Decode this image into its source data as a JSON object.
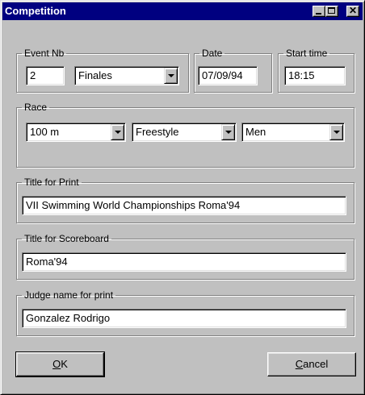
{
  "window": {
    "title": "Competition"
  },
  "titlebar_buttons": {
    "minimize_icon": "minimize-icon",
    "maximize_icon": "maximize-icon",
    "close_icon": "close-icon",
    "close_glyph": "✕"
  },
  "event": {
    "legend": "Event Nb",
    "number": "2",
    "phase": "Finales"
  },
  "date": {
    "legend": "Date",
    "value": "07/09/94"
  },
  "start_time": {
    "legend": "Start time",
    "value": "18:15"
  },
  "race": {
    "legend": "Race",
    "distance": "100 m",
    "stroke": "Freestyle",
    "category": "Men"
  },
  "print_title": {
    "legend": "Title for Print",
    "value": "VII Swimming World Championships Roma'94"
  },
  "scoreboard_title": {
    "legend": "Title for Scoreboard",
    "value": "Roma'94"
  },
  "judge": {
    "legend": "Judge name for print",
    "value": "Gonzalez Rodrigo"
  },
  "buttons": {
    "ok_mnemonic": "O",
    "ok_rest": "K",
    "cancel_mnemonic": "C",
    "cancel_rest": "ancel"
  },
  "colors": {
    "titlebar": "#000080",
    "face": "#c0c0c0",
    "field": "#ffffff"
  }
}
